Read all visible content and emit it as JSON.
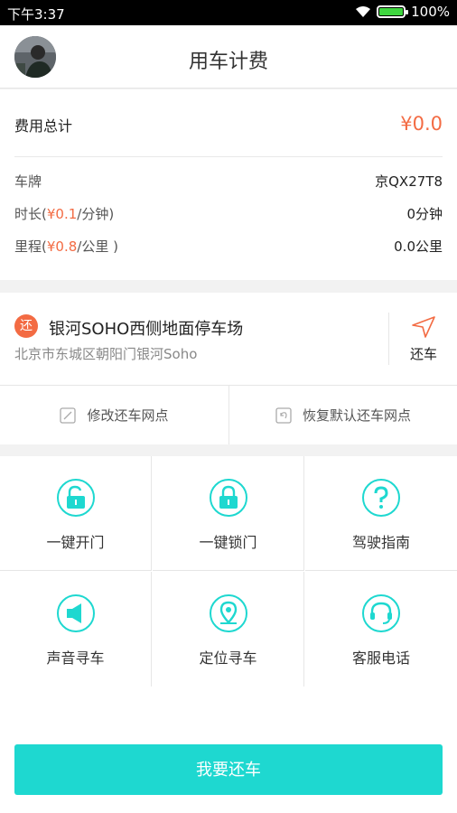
{
  "status_bar": {
    "time": "下午3:37",
    "battery": "100%",
    "battery_level": 1.0
  },
  "header": {
    "title": "用车计费"
  },
  "fees": {
    "total_label": "费用总计",
    "total_value": "¥0.0",
    "plate_label": "车牌",
    "plate_value": "京QX27T8",
    "duration": {
      "prefix": "时长(",
      "rate": "¥0.1",
      "suffix": "/分钟)",
      "value": "0分钟"
    },
    "mileage": {
      "prefix": "里程(",
      "rate": "¥0.8",
      "suffix": "/公里 )",
      "value": "0.0公里"
    }
  },
  "location": {
    "badge": "还",
    "name": "银河SOHO西侧地面停车场",
    "address": "北京市东城区朝阳门银河Soho",
    "return_label": "还车",
    "modify_label": "修改还车网点",
    "restore_label": "恢复默认还车网点"
  },
  "actions": [
    {
      "label": "一键开门",
      "icon": "unlock-icon"
    },
    {
      "label": "一键锁门",
      "icon": "lock-icon"
    },
    {
      "label": "驾驶指南",
      "icon": "question-icon"
    },
    {
      "label": "声音寻车",
      "icon": "speaker-icon"
    },
    {
      "label": "定位寻车",
      "icon": "location-pin-icon"
    },
    {
      "label": "客服电话",
      "icon": "headset-icon"
    }
  ],
  "submit_label": "我要还车",
  "colors": {
    "accent": "#1ed8d0",
    "price": "#f36b43"
  }
}
